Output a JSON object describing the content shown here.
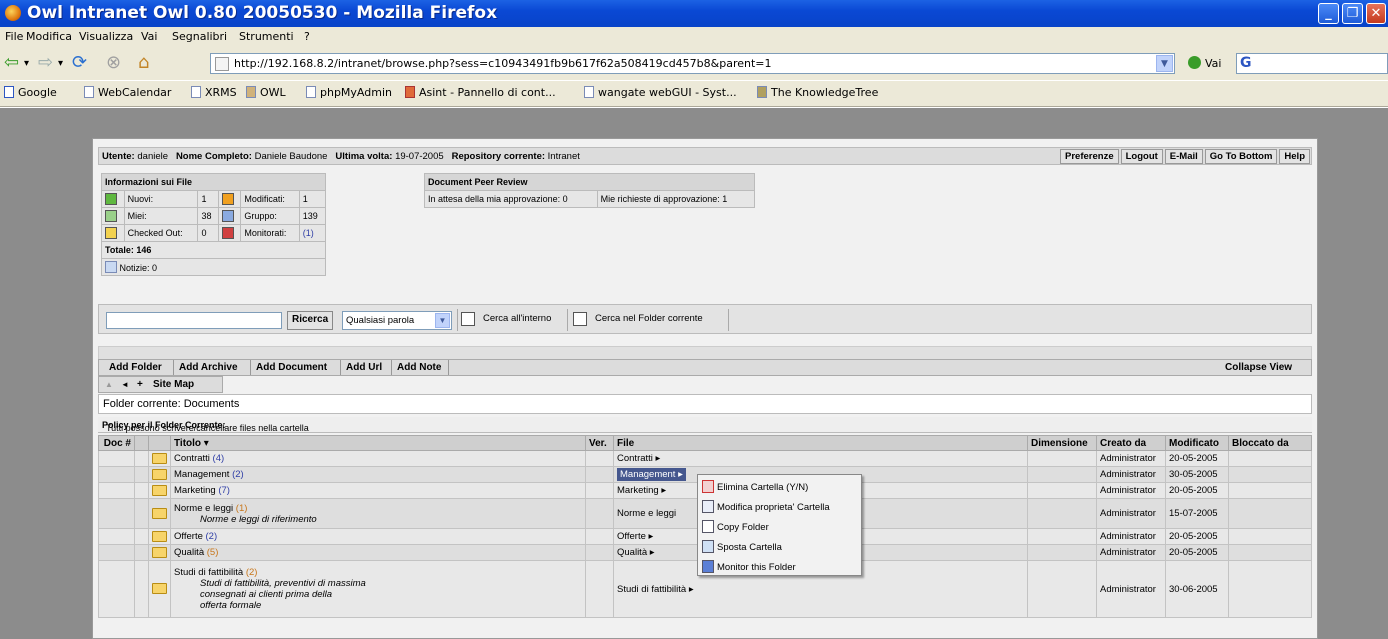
{
  "window": {
    "title": "Owl Intranet Owl 0.80 20050530 - Mozilla Firefox"
  },
  "menu": [
    "File",
    "Modifica",
    "Visualizza",
    "Vai",
    "Segnalibri",
    "Strumenti",
    "?"
  ],
  "address": {
    "url": "http://192.168.8.2/intranet/browse.php?sess=c10943491fb9b617f62a508419cd457b8&parent=1",
    "go_label": "Vai"
  },
  "bookmarks": [
    "Google",
    "WebCalendar",
    "XRMS",
    "OWL",
    "phpMyAdmin",
    "Asint - Pannello di cont...",
    "wangate webGUI - Syst...",
    "The KnowledgeTree"
  ],
  "userbar": {
    "user_label": "Utente:",
    "user": "daniele",
    "fullname_label": "Nome Completo:",
    "fullname": "Daniele Baudone",
    "last_label": "Ultima volta:",
    "last": "19-07-2005",
    "repo_label": "Repository corrente:",
    "repo": "Intranet",
    "buttons": [
      "Preferenze",
      "Logout",
      "E-Mail",
      "Go To Bottom",
      "Help"
    ]
  },
  "file_info": {
    "title": "Informazioni sui File",
    "nuovi_label": "Nuovi:",
    "nuovi": "1",
    "modificati_label": "Modificati:",
    "modificati": "1",
    "miei_label": "Miei:",
    "miei": "38",
    "gruppo_label": "Gruppo:",
    "gruppo": "139",
    "checked_label": "Checked Out:",
    "checked": "0",
    "monitorati_label": "Monitorati:",
    "monitorati": "(1)",
    "totale": "Totale: 146",
    "notizie": "Notizie: 0"
  },
  "peer_review": {
    "title": "Document Peer Review",
    "waiting": "In attesa della mia approvazione: 0",
    "requests": "Mie richieste di approvazione: 1"
  },
  "search": {
    "button": "Ricerca",
    "mode": "Qualsiasi parola",
    "inside_label": "Cerca all'interno",
    "current_label": "Cerca nel Folder corrente"
  },
  "actions": [
    "Add Folder",
    "Add Archive",
    "Add Document",
    "Add Url",
    "Add Note"
  ],
  "collapse": "Collapse View",
  "nav": {
    "up": "▲",
    "back": "◄",
    "plus": "+",
    "sitemap": "Site Map"
  },
  "current_folder": "Folder corrente: Documents",
  "policy": {
    "label": "Policy per il Folder Corrente:",
    "text": "Tutti possono scrivere/cancellare files nella cartella"
  },
  "columns": [
    "Doc #",
    "Titolo ▾",
    "Ver.",
    "File",
    "Dimensione",
    "Creato da",
    "Modificato",
    "Bloccato da"
  ],
  "rows": [
    {
      "title": "Contratti",
      "count": "(4)",
      "file": "Contratti",
      "creator": "Administrator",
      "modified": "20-05-2005"
    },
    {
      "title": "Management",
      "count": "(2)",
      "file": "Management",
      "creator": "Administrator",
      "modified": "30-05-2005"
    },
    {
      "title": "Marketing",
      "count": "(7)",
      "file": "Marketing",
      "creator": "Administrator",
      "modified": "20-05-2005"
    },
    {
      "title": "Norme e leggi",
      "count": "(1)",
      "desc": "Norme e leggi di riferimento",
      "file": "Norme e leggi",
      "creator": "Administrator",
      "modified": "15-07-2005"
    },
    {
      "title": "Offerte",
      "count": "(2)",
      "file": "Offerte",
      "creator": "Administrator",
      "modified": "20-05-2005"
    },
    {
      "title": "Qualità",
      "count": "(5)",
      "file": "Qualità",
      "creator": "Administrator",
      "modified": "20-05-2005"
    },
    {
      "title": "Studi di fattibilità",
      "count": "(2)",
      "desc1": "Studi di fattibilità, preventivi di massima",
      "desc2": "consegnati ai clienti prima della",
      "desc3": "offerta formale",
      "file": "Studi di fattibilità",
      "creator": "Administrator",
      "modified": "30-06-2005"
    }
  ],
  "context_menu": [
    "Elimina Cartella (Y/N)",
    "Modifica proprieta' Cartella",
    "Copy Folder",
    "Sposta Cartella",
    "Monitor this Folder"
  ]
}
